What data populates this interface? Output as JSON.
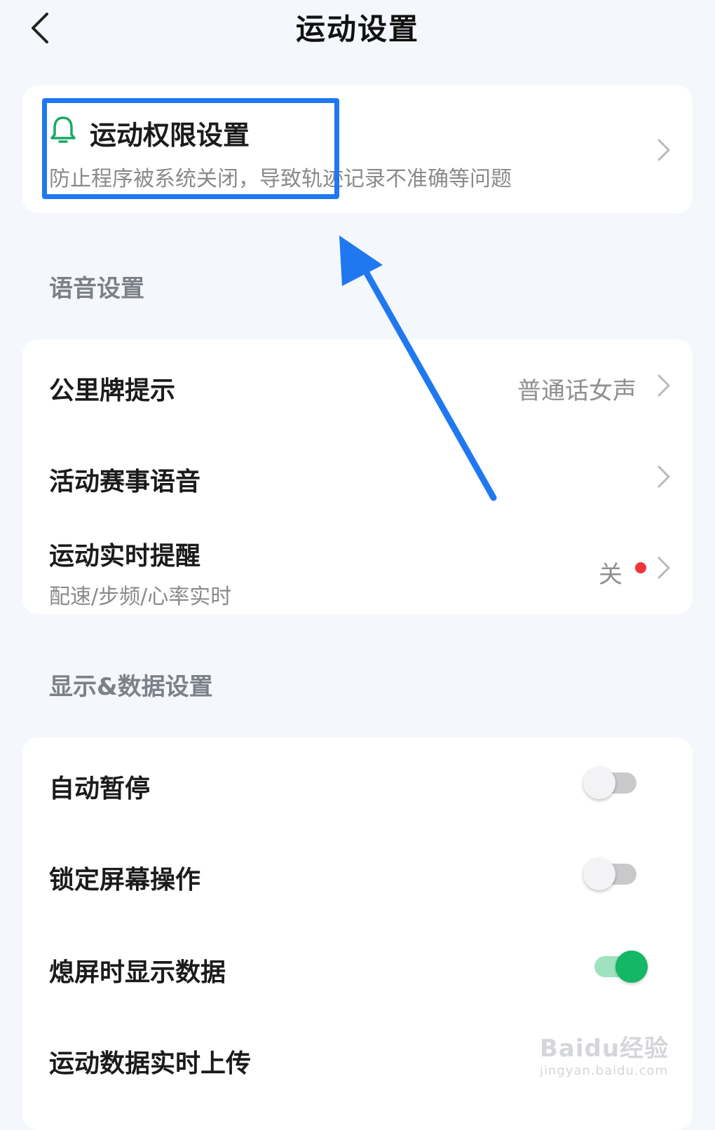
{
  "header": {
    "title": "运动设置",
    "back_icon": "chevron-left-icon"
  },
  "permission_card": {
    "icon": "bell-icon",
    "icon_color": "#1aa866",
    "title": "运动权限设置",
    "subtitle": "防止程序被系统关闭，导致轨迹记录不准确等问题"
  },
  "voice_section": {
    "title": "语音设置",
    "items": [
      {
        "label": "公里牌提示",
        "value": "普通话女声"
      },
      {
        "label": "活动赛事语音",
        "value": ""
      },
      {
        "label": "运动实时提醒",
        "subtitle": "配速/步频/心率实时",
        "value": "关"
      }
    ]
  },
  "display_section": {
    "title": "显示&数据设置",
    "items": [
      {
        "label": "自动暂停",
        "toggle_on": false
      },
      {
        "label": "锁定屏幕操作",
        "toggle_on": false
      },
      {
        "label": "熄屏时显示数据",
        "toggle_on": true
      },
      {
        "label": "运动数据实时上传"
      }
    ]
  },
  "annotation": {
    "highlight_color": "#1f78f0"
  },
  "watermark": {
    "main": "Baidu经验",
    "url": "jingyan.baidu.com"
  },
  "colors": {
    "toggle_on": "#14b765",
    "badge_red": "#f0353a",
    "background": "#f4f7fb"
  }
}
